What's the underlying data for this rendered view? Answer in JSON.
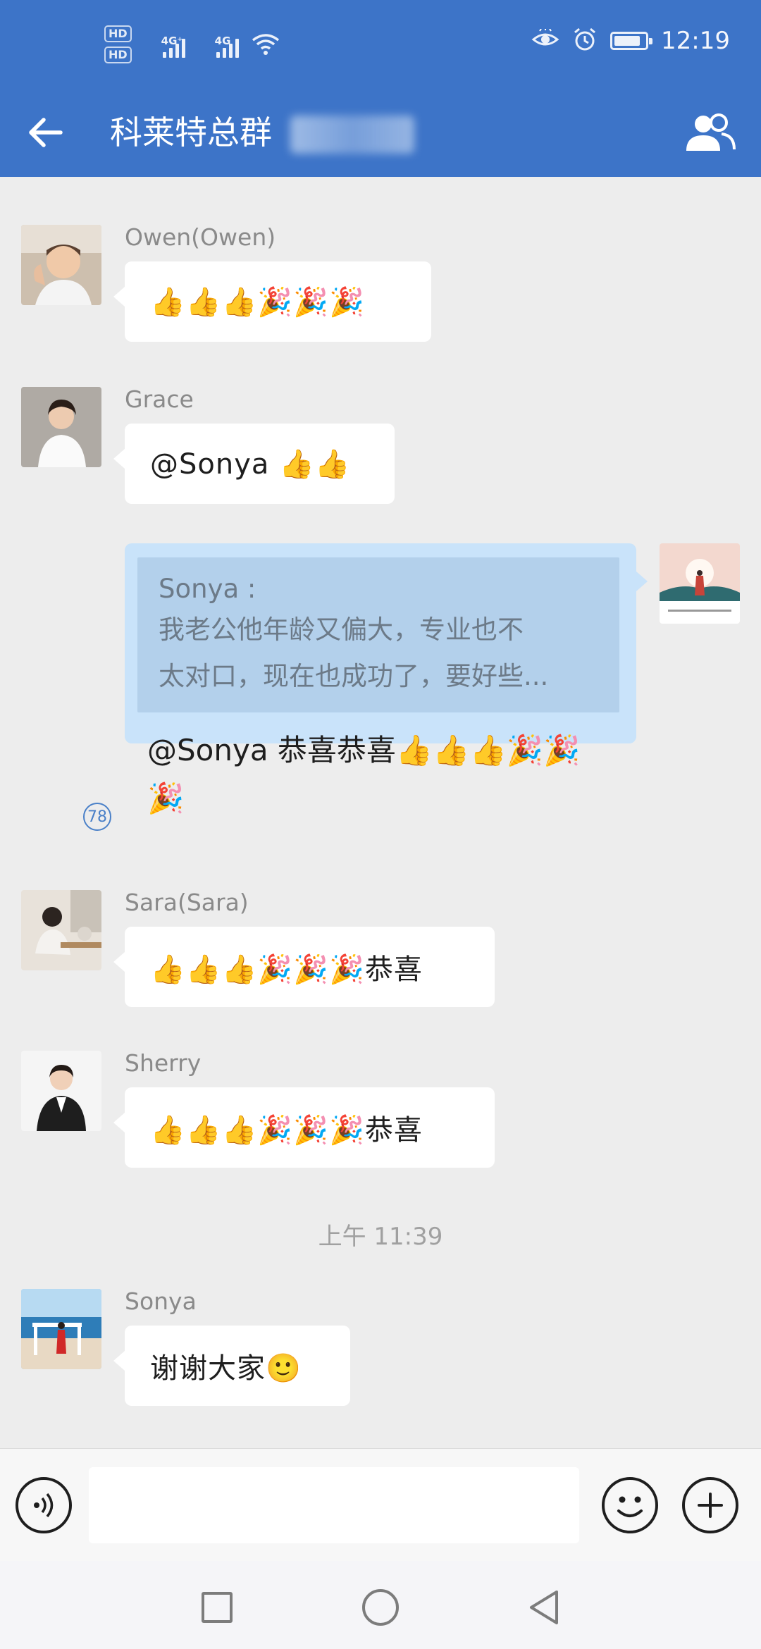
{
  "status_bar": {
    "hd1": "HD",
    "hd2": "HD",
    "net1": "4G⁺",
    "net2": "4G",
    "time": "12:19",
    "battery_level": 0.85,
    "icons": [
      "eye-comfort-icon",
      "alarm-icon",
      "battery-icon",
      "wifi-icon",
      "signal-icon"
    ]
  },
  "header": {
    "title": "科莱特总群",
    "back_icon": "arrow-left-icon",
    "members_icon": "group-members-icon",
    "background": "#3D74C8"
  },
  "messages": [
    {
      "sender": "Owen(Owen)",
      "text": "👍👍👍🎉🎉🎉",
      "avatar": "avatar-owen"
    },
    {
      "sender": "Grace",
      "text": "@Sonya  👍👍",
      "avatar": "avatar-grace"
    },
    {
      "self": true,
      "quote_sender": "Sonya :",
      "quote_line1": "我老公他年龄又偏大，专业也不",
      "quote_line2": "太对口，现在也成功了，要好些...",
      "text": "@Sonya  恭喜恭喜👍👍👍🎉🎉🎉",
      "read_count": "78",
      "bubble_color": "#C9E3FA"
    },
    {
      "sender": "Sara(Sara)",
      "text": "👍👍👍🎉🎉🎉恭喜",
      "avatar": "avatar-sara"
    },
    {
      "sender": "Sherry",
      "text": "👍👍👍🎉🎉🎉恭喜",
      "avatar": "avatar-sherry"
    },
    {
      "timestamp": "上午 11:39"
    },
    {
      "sender": "Sonya",
      "text": "谢谢大家🙂",
      "avatar": "avatar-sonya"
    }
  ],
  "input_bar": {
    "voice_icon": "voice-icon",
    "text_value": "",
    "emoji_icon": "smiley-icon",
    "plus_icon": "plus-icon"
  },
  "nav_bar": {
    "icons": [
      "recents-square-icon",
      "home-circle-icon",
      "back-triangle-icon"
    ]
  }
}
